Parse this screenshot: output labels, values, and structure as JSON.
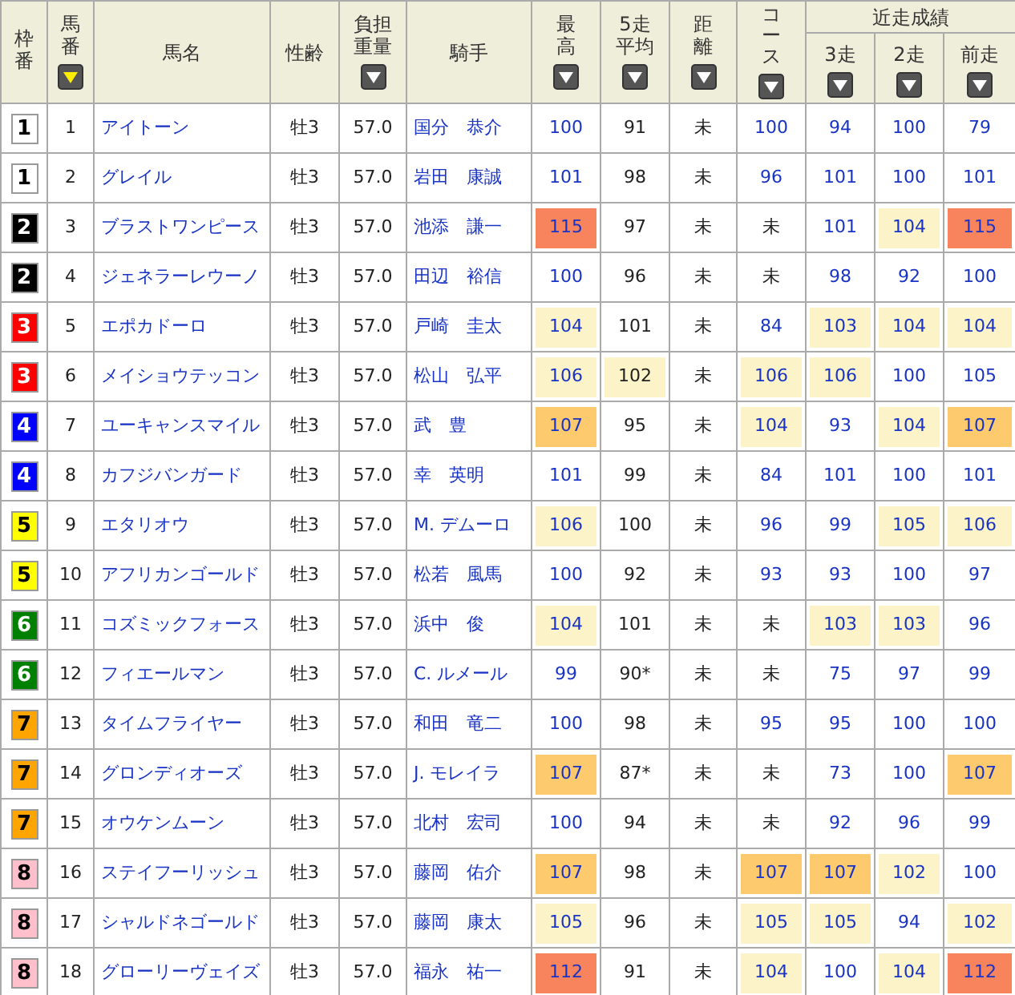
{
  "header": {
    "columns": [
      {
        "label": "枠番"
      },
      {
        "label": "馬番",
        "sorted": true
      },
      {
        "label": "馬名"
      },
      {
        "label": "性齢"
      },
      {
        "label": "負担重量",
        "sorted": false
      },
      {
        "label": "騎手"
      },
      {
        "label": "最高",
        "sorted": false
      },
      {
        "label": "5走平均",
        "sorted": false
      },
      {
        "label": "距離",
        "sorted": false
      },
      {
        "label": "コース",
        "sorted": false
      }
    ],
    "recent": {
      "label": "近走成績",
      "columns": [
        {
          "label": "3走",
          "sorted": false
        },
        {
          "label": "2走",
          "sorted": false
        },
        {
          "label": "前走",
          "sorted": false
        }
      ]
    }
  },
  "rows": [
    {
      "frame": {
        "text": "1",
        "color": "#ffffff"
      },
      "number": "1",
      "horse": "アイトーン",
      "sex_age": "牡3",
      "weight": "57.0",
      "jockey": "国分　恭介",
      "scores": [
        {
          "text": "100",
          "link": true
        },
        {
          "text": "91",
          "link": false
        },
        {
          "text": "未",
          "link": false
        },
        {
          "text": "100",
          "link": true
        },
        {
          "text": "94",
          "link": true
        },
        {
          "text": "100",
          "link": true
        },
        {
          "text": "79",
          "link": true
        }
      ]
    },
    {
      "frame": {
        "text": "1",
        "color": "#ffffff"
      },
      "number": "2",
      "horse": "グレイル",
      "sex_age": "牡3",
      "weight": "57.0",
      "jockey": "岩田　康誠",
      "scores": [
        {
          "text": "101",
          "link": true
        },
        {
          "text": "98",
          "link": false
        },
        {
          "text": "未",
          "link": false
        },
        {
          "text": "96",
          "link": true
        },
        {
          "text": "101",
          "link": true
        },
        {
          "text": "100",
          "link": true
        },
        {
          "text": "101",
          "link": true
        }
      ]
    },
    {
      "frame": {
        "text": "2",
        "color": "#000000"
      },
      "number": "3",
      "horse": "ブラストワンピース",
      "sex_age": "牡3",
      "weight": "57.0",
      "jockey": "池添　謙一",
      "scores": [
        {
          "text": "115",
          "link": true,
          "color": "#f7845c"
        },
        {
          "text": "97",
          "link": false
        },
        {
          "text": "未",
          "link": false
        },
        {
          "text": "未",
          "link": false
        },
        {
          "text": "101",
          "link": true
        },
        {
          "text": "104",
          "link": true,
          "color": "#fdf3c9"
        },
        {
          "text": "115",
          "link": true,
          "color": "#f7845c"
        }
      ]
    },
    {
      "frame": {
        "text": "2",
        "color": "#000000"
      },
      "number": "4",
      "horse": "ジェネラーレウーノ",
      "sex_age": "牡3",
      "weight": "57.0",
      "jockey": "田辺　裕信",
      "scores": [
        {
          "text": "100",
          "link": true
        },
        {
          "text": "96",
          "link": false
        },
        {
          "text": "未",
          "link": false
        },
        {
          "text": "未",
          "link": false
        },
        {
          "text": "98",
          "link": true
        },
        {
          "text": "92",
          "link": true
        },
        {
          "text": "100",
          "link": true
        }
      ]
    },
    {
      "frame": {
        "text": "3",
        "color": "#ff0000"
      },
      "number": "5",
      "horse": "エポカドーロ",
      "sex_age": "牡3",
      "weight": "57.0",
      "jockey": "戸崎　圭太",
      "scores": [
        {
          "text": "104",
          "link": true,
          "color": "#fdf3c9"
        },
        {
          "text": "101",
          "link": false
        },
        {
          "text": "未",
          "link": false
        },
        {
          "text": "84",
          "link": true
        },
        {
          "text": "103",
          "link": true,
          "color": "#fdf3c9"
        },
        {
          "text": "104",
          "link": true,
          "color": "#fdf3c9"
        },
        {
          "text": "104",
          "link": true,
          "color": "#fdf3c9"
        }
      ]
    },
    {
      "frame": {
        "text": "3",
        "color": "#ff0000"
      },
      "number": "6",
      "horse": "メイショウテッコン",
      "sex_age": "牡3",
      "weight": "57.0",
      "jockey": "松山　弘平",
      "scores": [
        {
          "text": "106",
          "link": true,
          "color": "#fdf3c9"
        },
        {
          "text": "102",
          "link": false,
          "color": "#fdf3c9"
        },
        {
          "text": "未",
          "link": false
        },
        {
          "text": "106",
          "link": true,
          "color": "#fdf3c9"
        },
        {
          "text": "106",
          "link": true,
          "color": "#fdf3c9"
        },
        {
          "text": "100",
          "link": true
        },
        {
          "text": "105",
          "link": true
        }
      ]
    },
    {
      "frame": {
        "text": "4",
        "color": "#0000ff"
      },
      "number": "7",
      "horse": "ユーキャンスマイル",
      "sex_age": "牡3",
      "weight": "57.0",
      "jockey": "武　豊",
      "scores": [
        {
          "text": "107",
          "link": true,
          "color": "#fdcb6e"
        },
        {
          "text": "95",
          "link": false
        },
        {
          "text": "未",
          "link": false
        },
        {
          "text": "104",
          "link": true,
          "color": "#fdf3c9"
        },
        {
          "text": "93",
          "link": true
        },
        {
          "text": "104",
          "link": true,
          "color": "#fdf3c9"
        },
        {
          "text": "107",
          "link": true,
          "color": "#fdcb6e"
        }
      ]
    },
    {
      "frame": {
        "text": "4",
        "color": "#0000ff"
      },
      "number": "8",
      "horse": "カフジバンガード",
      "sex_age": "牡3",
      "weight": "57.0",
      "jockey": "幸　英明",
      "scores": [
        {
          "text": "101",
          "link": true
        },
        {
          "text": "99",
          "link": false
        },
        {
          "text": "未",
          "link": false
        },
        {
          "text": "84",
          "link": true
        },
        {
          "text": "101",
          "link": true
        },
        {
          "text": "100",
          "link": true
        },
        {
          "text": "101",
          "link": true
        }
      ]
    },
    {
      "frame": {
        "text": "5",
        "color": "#ffff00"
      },
      "number": "9",
      "horse": "エタリオウ",
      "sex_age": "牡3",
      "weight": "57.0",
      "jockey": "M. デムーロ",
      "scores": [
        {
          "text": "106",
          "link": true,
          "color": "#fdf3c9"
        },
        {
          "text": "100",
          "link": false
        },
        {
          "text": "未",
          "link": false
        },
        {
          "text": "96",
          "link": true
        },
        {
          "text": "99",
          "link": true
        },
        {
          "text": "105",
          "link": true,
          "color": "#fdf3c9"
        },
        {
          "text": "106",
          "link": true,
          "color": "#fdf3c9"
        }
      ]
    },
    {
      "frame": {
        "text": "5",
        "color": "#ffff00"
      },
      "number": "10",
      "horse": "アフリカンゴールド",
      "sex_age": "牡3",
      "weight": "57.0",
      "jockey": "松若　風馬",
      "scores": [
        {
          "text": "100",
          "link": true
        },
        {
          "text": "92",
          "link": false
        },
        {
          "text": "未",
          "link": false
        },
        {
          "text": "93",
          "link": true
        },
        {
          "text": "93",
          "link": true
        },
        {
          "text": "100",
          "link": true
        },
        {
          "text": "97",
          "link": true
        }
      ]
    },
    {
      "frame": {
        "text": "6",
        "color": "#008000"
      },
      "number": "11",
      "horse": "コズミックフォース",
      "sex_age": "牡3",
      "weight": "57.0",
      "jockey": "浜中　俊",
      "scores": [
        {
          "text": "104",
          "link": true,
          "color": "#fdf3c9"
        },
        {
          "text": "101",
          "link": false
        },
        {
          "text": "未",
          "link": false
        },
        {
          "text": "未",
          "link": false
        },
        {
          "text": "103",
          "link": true,
          "color": "#fdf3c9"
        },
        {
          "text": "103",
          "link": true,
          "color": "#fdf3c9"
        },
        {
          "text": "96",
          "link": true
        }
      ]
    },
    {
      "frame": {
        "text": "6",
        "color": "#008000"
      },
      "number": "12",
      "horse": "フィエールマン",
      "sex_age": "牡3",
      "weight": "57.0",
      "jockey": "C. ルメール",
      "scores": [
        {
          "text": "99",
          "link": true
        },
        {
          "text": "90*",
          "link": false
        },
        {
          "text": "未",
          "link": false
        },
        {
          "text": "未",
          "link": false
        },
        {
          "text": "75",
          "link": true
        },
        {
          "text": "97",
          "link": true
        },
        {
          "text": "99",
          "link": true
        }
      ]
    },
    {
      "frame": {
        "text": "7",
        "color": "#ffa500"
      },
      "number": "13",
      "horse": "タイムフライヤー",
      "sex_age": "牡3",
      "weight": "57.0",
      "jockey": "和田　竜二",
      "scores": [
        {
          "text": "100",
          "link": true
        },
        {
          "text": "98",
          "link": false
        },
        {
          "text": "未",
          "link": false
        },
        {
          "text": "95",
          "link": true
        },
        {
          "text": "95",
          "link": true
        },
        {
          "text": "100",
          "link": true
        },
        {
          "text": "100",
          "link": true
        }
      ]
    },
    {
      "frame": {
        "text": "7",
        "color": "#ffa500"
      },
      "number": "14",
      "horse": "グロンディオーズ",
      "sex_age": "牡3",
      "weight": "57.0",
      "jockey": "J. モレイラ",
      "scores": [
        {
          "text": "107",
          "link": true,
          "color": "#fdcb6e"
        },
        {
          "text": "87*",
          "link": false
        },
        {
          "text": "未",
          "link": false
        },
        {
          "text": "未",
          "link": false
        },
        {
          "text": "73",
          "link": true
        },
        {
          "text": "100",
          "link": true
        },
        {
          "text": "107",
          "link": true,
          "color": "#fdcb6e"
        }
      ]
    },
    {
      "frame": {
        "text": "7",
        "color": "#ffa500"
      },
      "number": "15",
      "horse": "オウケンムーン",
      "sex_age": "牡3",
      "weight": "57.0",
      "jockey": "北村　宏司",
      "scores": [
        {
          "text": "100",
          "link": true
        },
        {
          "text": "94",
          "link": false
        },
        {
          "text": "未",
          "link": false
        },
        {
          "text": "未",
          "link": false
        },
        {
          "text": "92",
          "link": true
        },
        {
          "text": "96",
          "link": true
        },
        {
          "text": "99",
          "link": true
        }
      ]
    },
    {
      "frame": {
        "text": "8",
        "color": "#ffc0cb"
      },
      "number": "16",
      "horse": "ステイフーリッシュ",
      "sex_age": "牡3",
      "weight": "57.0",
      "jockey": "藤岡　佑介",
      "scores": [
        {
          "text": "107",
          "link": true,
          "color": "#fdcb6e"
        },
        {
          "text": "98",
          "link": false
        },
        {
          "text": "未",
          "link": false
        },
        {
          "text": "107",
          "link": true,
          "color": "#fdcb6e"
        },
        {
          "text": "107",
          "link": true,
          "color": "#fdcb6e"
        },
        {
          "text": "102",
          "link": true,
          "color": "#fdf3c9"
        },
        {
          "text": "100",
          "link": true
        }
      ]
    },
    {
      "frame": {
        "text": "8",
        "color": "#ffc0cb"
      },
      "number": "17",
      "horse": "シャルドネゴールド",
      "sex_age": "牡3",
      "weight": "57.0",
      "jockey": "藤岡　康太",
      "scores": [
        {
          "text": "105",
          "link": true,
          "color": "#fdf3c9"
        },
        {
          "text": "96",
          "link": false
        },
        {
          "text": "未",
          "link": false
        },
        {
          "text": "105",
          "link": true,
          "color": "#fdf3c9"
        },
        {
          "text": "105",
          "link": true,
          "color": "#fdf3c9"
        },
        {
          "text": "94",
          "link": true
        },
        {
          "text": "102",
          "link": true,
          "color": "#fdf3c9"
        }
      ]
    },
    {
      "frame": {
        "text": "8",
        "color": "#ffc0cb"
      },
      "number": "18",
      "horse": "グローリーヴェイズ",
      "sex_age": "牡3",
      "weight": "57.0",
      "jockey": "福永　祐一",
      "scores": [
        {
          "text": "112",
          "link": true,
          "color": "#f7845c"
        },
        {
          "text": "91",
          "link": false
        },
        {
          "text": "未",
          "link": false
        },
        {
          "text": "104",
          "link": true,
          "color": "#fdf3c9"
        },
        {
          "text": "100",
          "link": true
        },
        {
          "text": "104",
          "link": true,
          "color": "#fdf3c9"
        },
        {
          "text": "112",
          "link": true,
          "color": "#f7845c"
        }
      ]
    }
  ]
}
